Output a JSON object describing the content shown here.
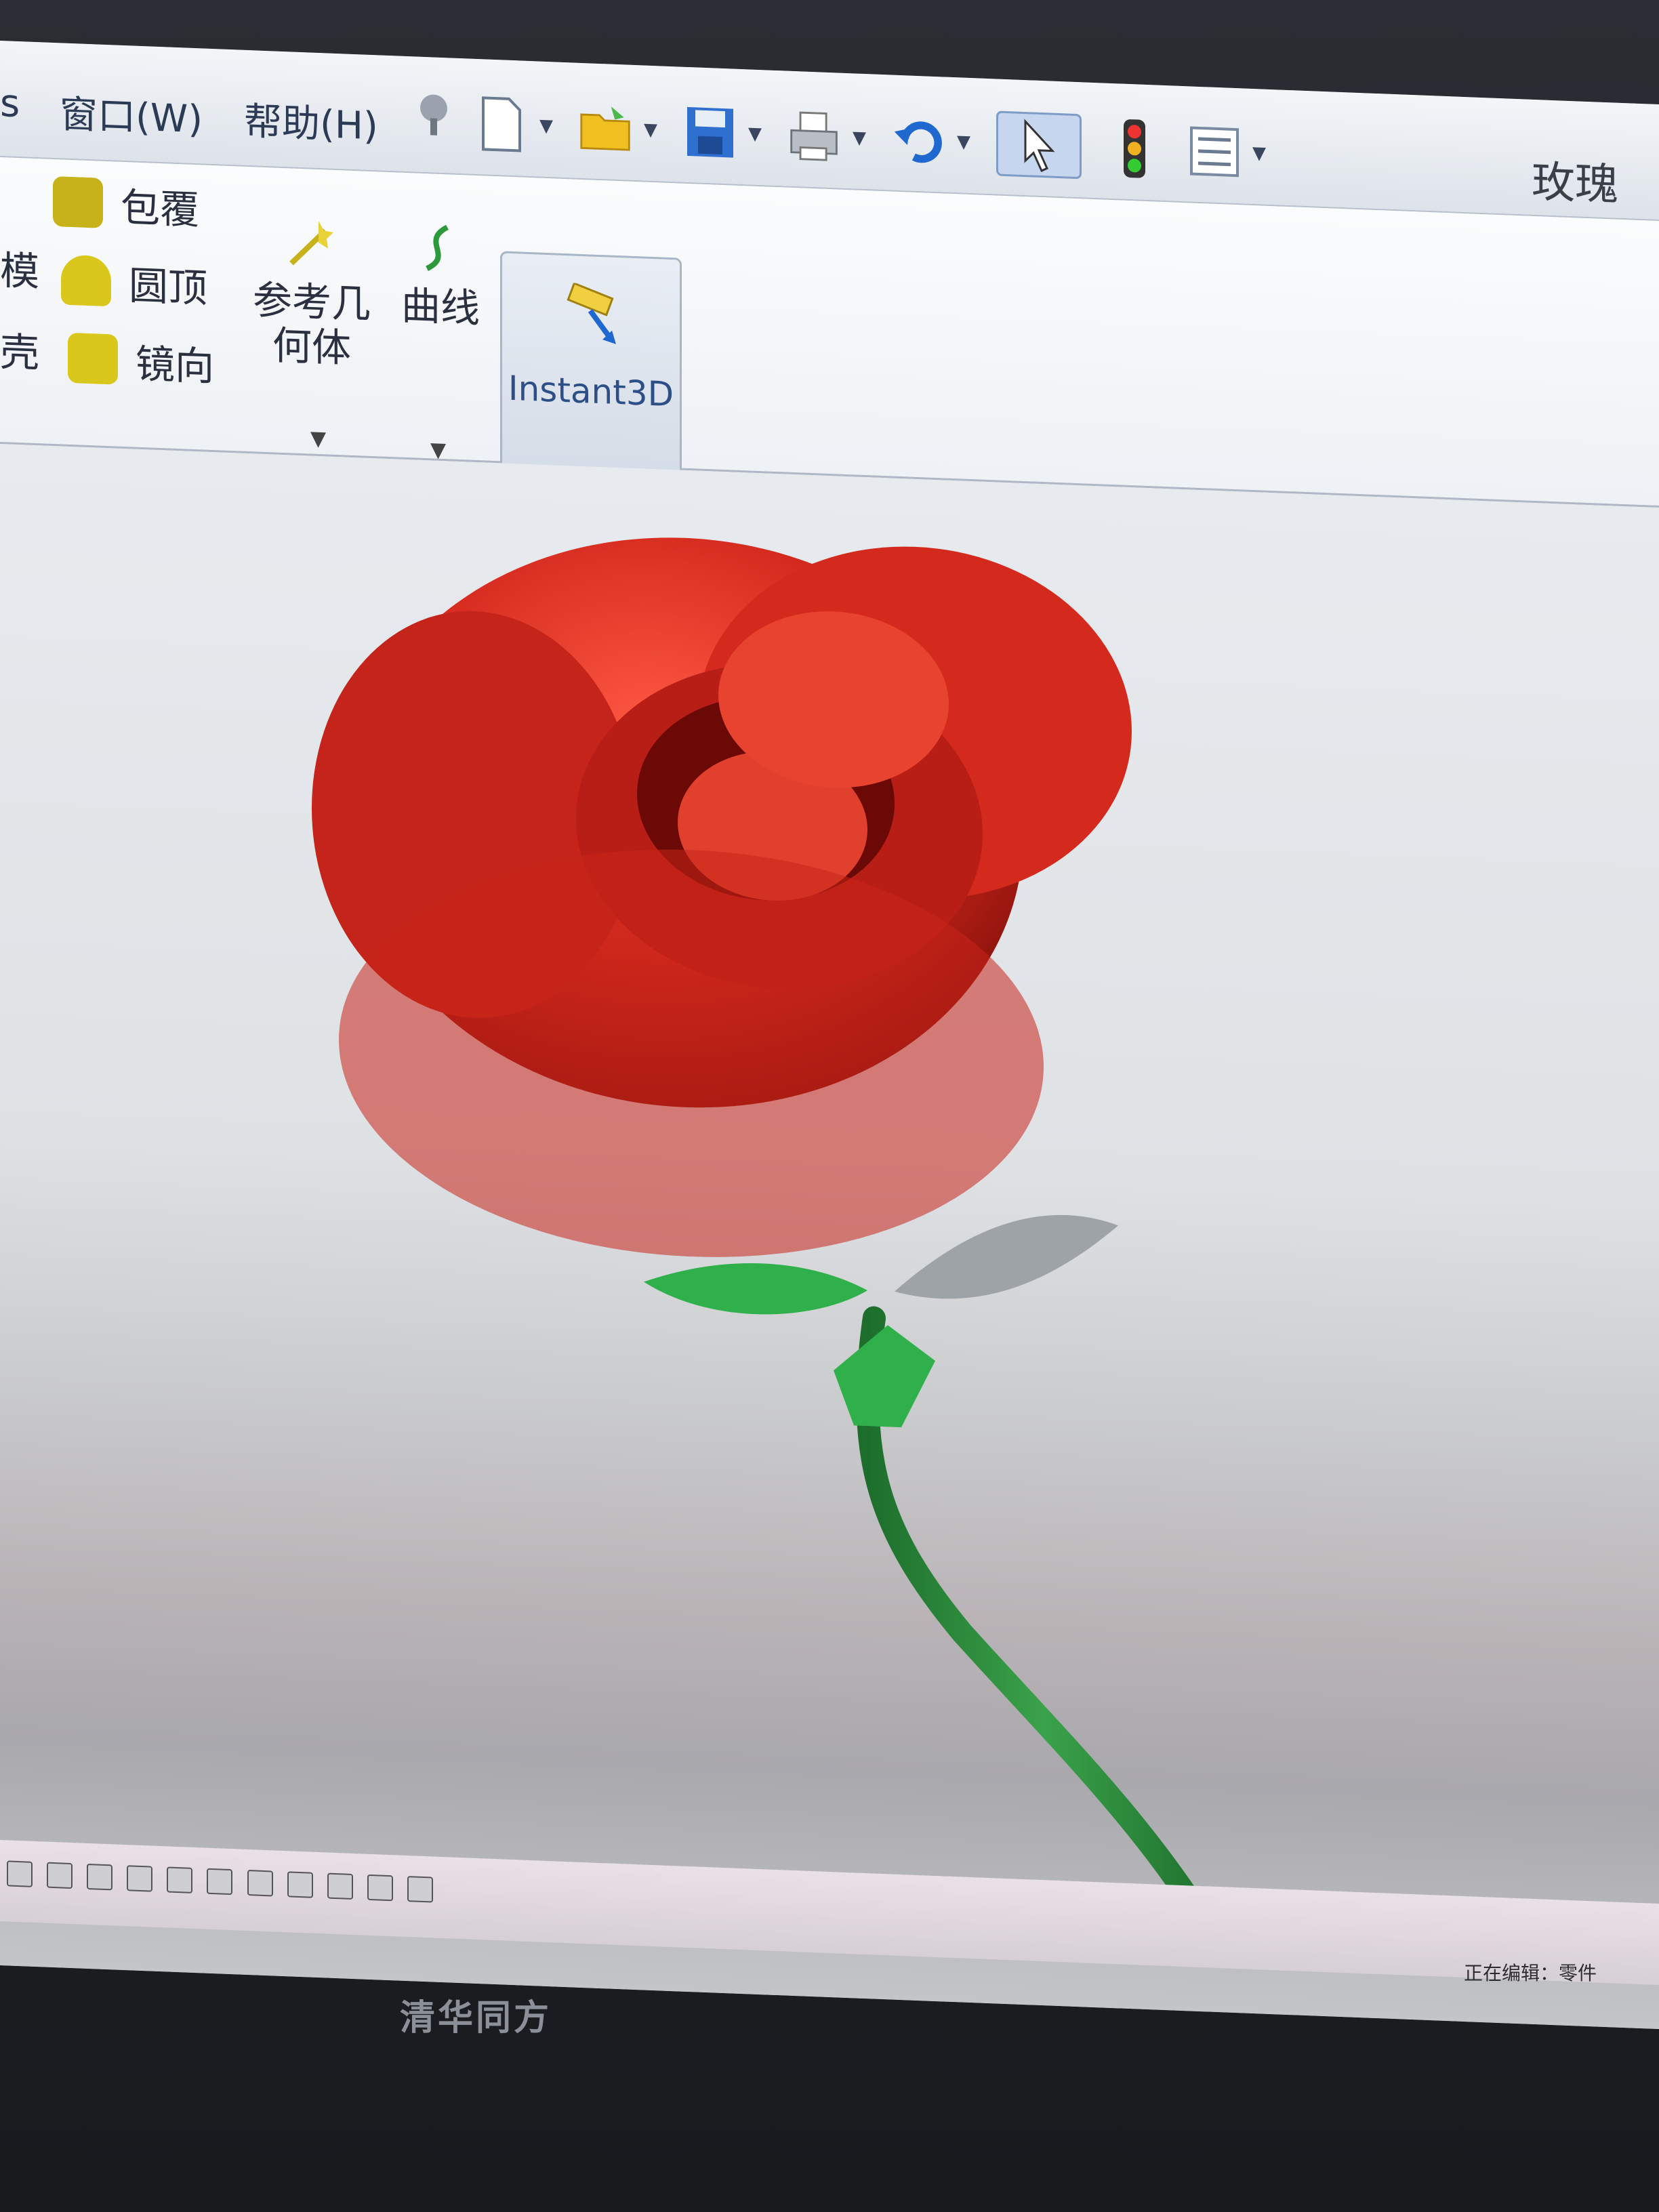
{
  "menubar": {
    "items": [
      {
        "label": "s"
      },
      {
        "label": "窗口(W)"
      },
      {
        "label": "帮助(H)"
      }
    ],
    "document_title": "玫瑰花"
  },
  "toolbar": {
    "icons": [
      "pin-icon",
      "new-document-icon",
      "open-folder-icon",
      "save-icon",
      "print-icon",
      "undo-icon",
      "select-pointer-icon",
      "rebuild-icon",
      "options-icon"
    ]
  },
  "ribbon": {
    "left_partial": [
      "模",
      "壳"
    ],
    "features": [
      {
        "label": "包覆",
        "icon": "wrap-icon",
        "color": "#c8b21a"
      },
      {
        "label": "圆顶",
        "icon": "dome-icon",
        "color": "#d9c81b"
      },
      {
        "label": "镜向",
        "icon": "mirror-icon",
        "color": "#d9c81b"
      }
    ],
    "reference_geometry": {
      "line1": "参考几",
      "line2": "何体"
    },
    "curves": "曲线",
    "instant3d": "Instant3D"
  },
  "viewport": {
    "model": "rose",
    "colors": {
      "petal": "#d42a1e",
      "petal_dark": "#8c0f0a",
      "stem": "#2a8a3a",
      "leaf": "#2fb04a"
    }
  },
  "statusbar": {
    "text": "正在编辑：零件"
  },
  "monitor": {
    "brand": "清华同方"
  }
}
